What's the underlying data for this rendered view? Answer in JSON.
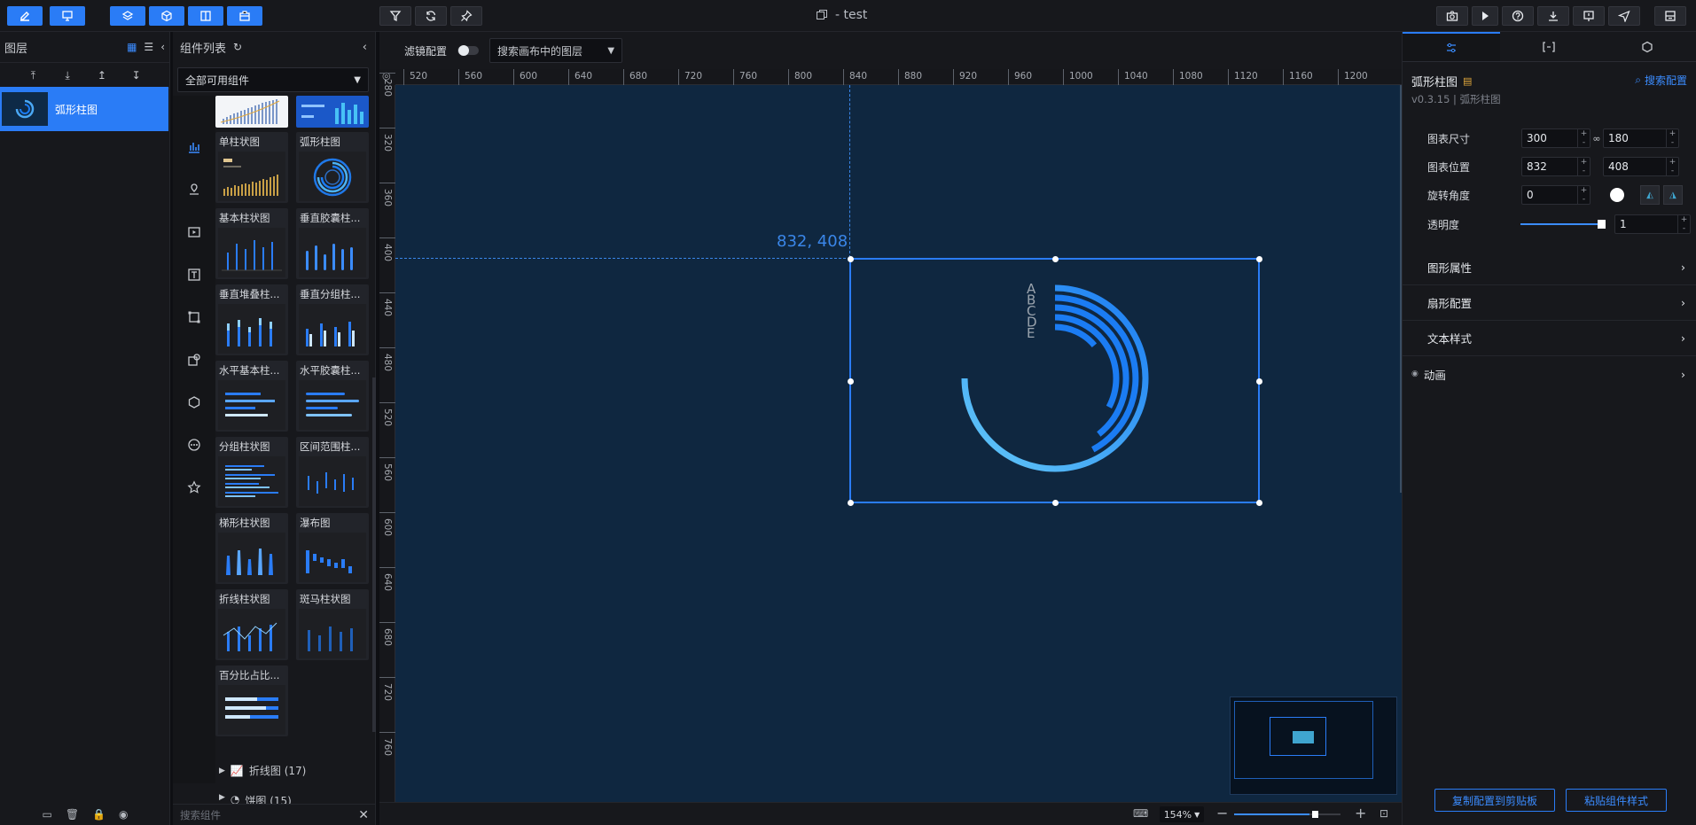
{
  "window": {
    "title": "- test"
  },
  "layers": {
    "title": "图层",
    "items": [
      {
        "label": "弧形柱图"
      }
    ]
  },
  "components": {
    "title": "组件列表",
    "category_select": "全部可用组件",
    "cards": [
      {
        "label": "单柱状图"
      },
      {
        "label": "弧形柱图"
      },
      {
        "label": "基本柱状图"
      },
      {
        "label": "垂直胶囊柱..."
      },
      {
        "label": "垂直堆叠柱..."
      },
      {
        "label": "垂直分组柱..."
      },
      {
        "label": "水平基本柱..."
      },
      {
        "label": "水平胶囊柱..."
      },
      {
        "label": "分组柱状图"
      },
      {
        "label": "区间范围柱..."
      },
      {
        "label": "梯形柱状图"
      },
      {
        "label": "瀑布图"
      },
      {
        "label": "折线柱状图"
      },
      {
        "label": "斑马柱状图"
      },
      {
        "label": "百分比占比..."
      }
    ],
    "collapsed_groups": [
      {
        "label": "折线图 (17)"
      },
      {
        "label": "饼图 (15)"
      }
    ],
    "search_placeholder": "搜索组件"
  },
  "canvas_toolbar": {
    "filter_label": "滤镜配置",
    "layer_search_placeholder": "搜索画布中的图层"
  },
  "canvas": {
    "ruler_h": [
      "520",
      "560",
      "600",
      "640",
      "680",
      "720",
      "760",
      "800",
      "840",
      "880",
      "920",
      "960",
      "1000",
      "1040",
      "1080",
      "1120",
      "1160",
      "1200"
    ],
    "ruler_v": [
      "280",
      "320",
      "360",
      "400",
      "440",
      "480",
      "520",
      "560",
      "600",
      "640",
      "680",
      "720",
      "760"
    ],
    "coord_label": "832, 408",
    "chart_labels": [
      "A",
      "B",
      "C",
      "D",
      "E"
    ]
  },
  "statusbar": {
    "zoom": "154%"
  },
  "config": {
    "component_name": "弧形柱图",
    "version": "v0.3.15 | 弧形柱图",
    "search_config": "搜索配置",
    "size_label": "图表尺寸",
    "width": "300",
    "height": "180",
    "position_label": "图表位置",
    "x": "832",
    "y": "408",
    "rotation_label": "旋转角度",
    "rotation": "0",
    "opacity_label": "透明度",
    "opacity": "1",
    "opacity_fraction": 1,
    "sections": [
      {
        "label": "图形属性"
      },
      {
        "label": "扇形配置"
      },
      {
        "label": "文本样式"
      },
      {
        "label": "动画"
      }
    ],
    "copy_button": "复制配置到剪贴板",
    "paste_button": "粘贴组件样式"
  },
  "colors": {
    "accent": "#2a7cf6",
    "canvas_bg": "#0f2740",
    "arc_start": "#63c8f8",
    "arc_end": "#1b7cf3"
  }
}
